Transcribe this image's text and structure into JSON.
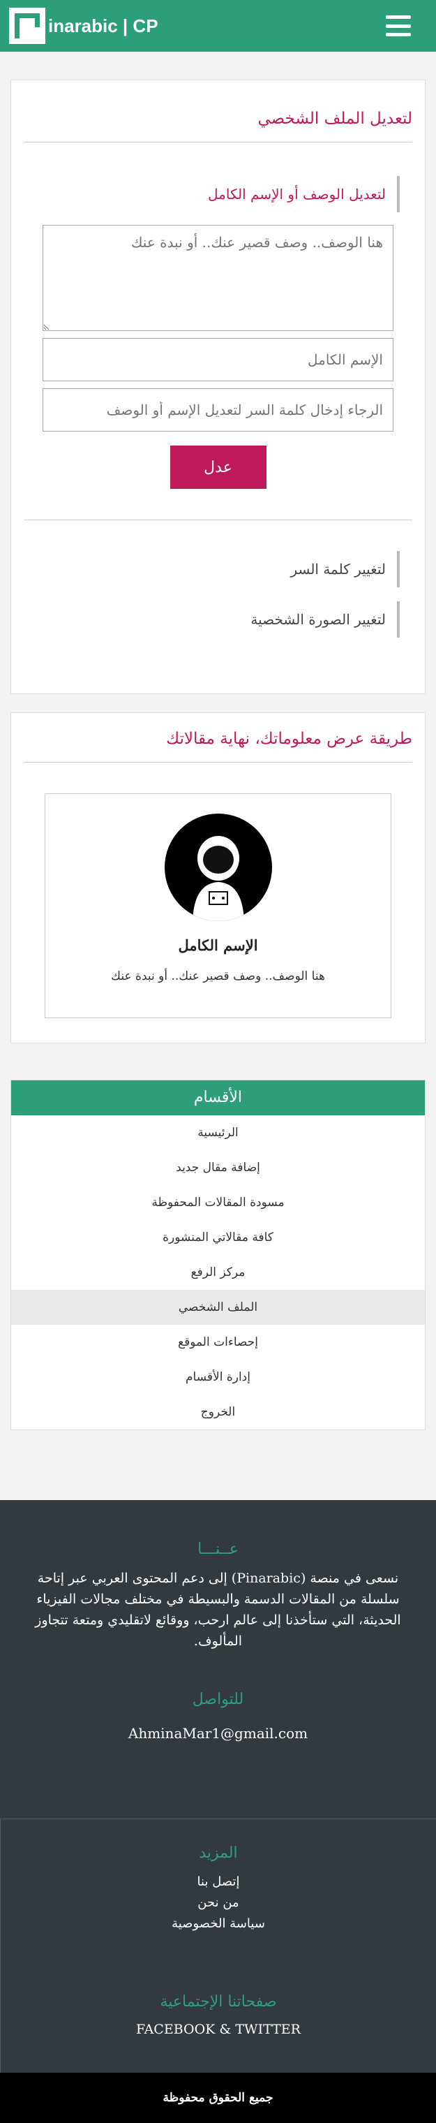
{
  "header": {
    "logo_text": "inarabic | CP"
  },
  "edit_profile": {
    "title": "لتعديل الملف الشخصي",
    "subtitle": "لتعديل الوصف أو الإسم الكامل",
    "description_placeholder": "هنا الوصف.. وصف قصير عنك.. أو نبدة عنك",
    "fullname_placeholder": "الإسم الكامل",
    "password_placeholder": "الرجاء إدخال كلمة السر لتعديل الإسم أو الوصف",
    "submit_label": "عدل",
    "change_password": "لتغيير كلمة السر",
    "change_photo": "لتغيير الصورة الشخصية"
  },
  "preview": {
    "title": "طريقة عرض معلوماتك، نهاية مقالاتك",
    "name": "الإسم الكامل",
    "description": "هنا الوصف.. وصف قصير عنك.. أو نبدة عنك"
  },
  "categories": {
    "title": "الأقسام",
    "items": [
      "الرئيسية",
      "إضافة مقال جديد",
      "مسودة المقالات المحفوظة",
      "كافة مقالاتي المنشورة",
      "مركز الرفع",
      "الملف الشخصي",
      "إحصاءات الموقع",
      "إدارة الأقسام",
      "الخروج"
    ],
    "active_index": 5
  },
  "footer": {
    "about_title": "عــنـــا",
    "about_text": "نسعى في منصة (Pinarabic) إلى دعم المحتوى العربي عبر إتاحة سلسلة من المقالات الدسمة والبسيطة في مختلف مجالات الفيزياء الحديثة، التي ستأخذنا إلى عالم ارحب، ووقائع لاتقليدي ومتعة تتجاوز المألوف.",
    "contact_title": "للتواصل",
    "email": "AhminaMar1@gmail.com",
    "more_title": "المزيد",
    "links": [
      "إتصل بنا",
      "من نحن",
      "سياسة الخصوصية"
    ],
    "social_title": "صفحاتنا الإجتماعية",
    "social": "FACEBOOK & TWITTER",
    "copyright": "جميع الحقوق محفوظة"
  },
  "colors": {
    "brand_green": "#2c9e7a",
    "accent": "#c0195a",
    "footer_bg": "#333a3f"
  },
  "icons": [
    "logo-icon",
    "menu-icon",
    "astronaut-avatar"
  ]
}
